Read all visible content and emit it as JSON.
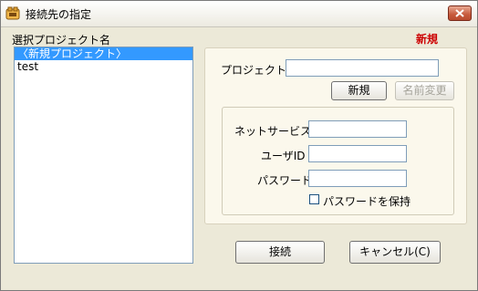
{
  "window": {
    "title": "接続先の指定",
    "icon": "app-icon"
  },
  "labels": {
    "project_list": "選択プロジェクト名",
    "mode_badge": "新規"
  },
  "project_list": {
    "items": [
      "〈新規プロジェクト〉",
      "test"
    ],
    "selected_index": 0
  },
  "project_form": {
    "name_label": "プロジェクト名",
    "name_value": "",
    "new_button": "新規",
    "rename_button": "名前変更"
  },
  "connection": {
    "network_service_label": "ネットサービス名",
    "network_service_value": "",
    "user_id_label": "ユーザID",
    "user_id_value": "",
    "password_label": "パスワード",
    "password_value": "",
    "keep_password_label": "パスワードを保持",
    "keep_password_checked": false
  },
  "buttons": {
    "connect": "接続",
    "cancel": "キャンセル(C)"
  }
}
